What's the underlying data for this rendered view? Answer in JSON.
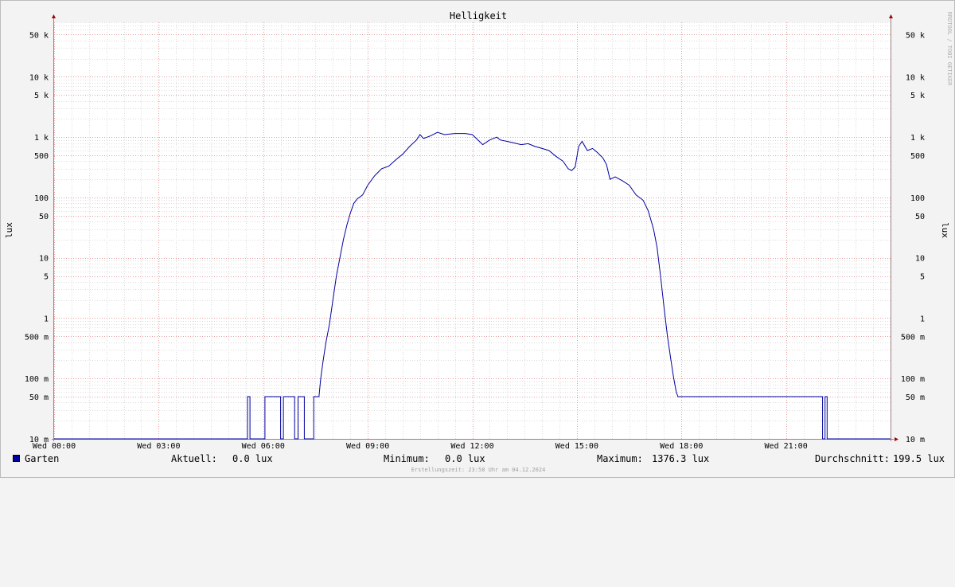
{
  "watermark": "RRDTOOL / TOBI OETIKER",
  "legend": {
    "series_name": "Garten",
    "series_color": "#0000a0",
    "current_label": "Aktuell:",
    "current_value": "0.0 lux",
    "min_label": "Minimum:",
    "min_value": "0.0 lux",
    "max_label": "Maximum:",
    "max_value": "1376.3 lux",
    "avg_label": "Durchschnitt:",
    "avg_value": "199.5 lux"
  },
  "footer": "Erstellungszeit: 23:58 Uhr am 04.12.2024",
  "colors": {
    "background": "#f3f3f3",
    "plot_background": "#ffffff",
    "grid_minor": "#dcdcdc",
    "grid_major": "#e8a0a0",
    "axis": "#a08080",
    "arrow": "#a00000",
    "line": "#0000a0"
  },
  "chart_data": {
    "type": "line",
    "title": "Helligkeit",
    "xlabel": "",
    "ylabel": "lux",
    "ylabel_right": "lux",
    "y_scale": "log",
    "ylim": [
      0.01,
      80000
    ],
    "xlim": [
      0,
      24
    ],
    "grid": true,
    "legend_position": "bottom",
    "x_ticks": [
      {
        "value": 0,
        "label": "Wed 00:00"
      },
      {
        "value": 3,
        "label": "Wed 03:00"
      },
      {
        "value": 6,
        "label": "Wed 06:00"
      },
      {
        "value": 9,
        "label": "Wed 09:00"
      },
      {
        "value": 12,
        "label": "Wed 12:00"
      },
      {
        "value": 15,
        "label": "Wed 15:00"
      },
      {
        "value": 18,
        "label": "Wed 18:00"
      },
      {
        "value": 21,
        "label": "Wed 21:00"
      }
    ],
    "y_ticks": [
      {
        "value": 0.01,
        "label": "10 m"
      },
      {
        "value": 0.05,
        "label": "50 m"
      },
      {
        "value": 0.1,
        "label": "100 m"
      },
      {
        "value": 0.5,
        "label": "500 m"
      },
      {
        "value": 1,
        "label": "1"
      },
      {
        "value": 5,
        "label": "5"
      },
      {
        "value": 10,
        "label": "10"
      },
      {
        "value": 50,
        "label": "50"
      },
      {
        "value": 100,
        "label": "100"
      },
      {
        "value": 500,
        "label": "500"
      },
      {
        "value": 1000,
        "label": "1 k"
      },
      {
        "value": 5000,
        "label": "5 k"
      },
      {
        "value": 10000,
        "label": "10 k"
      },
      {
        "value": 50000,
        "label": "50 k"
      }
    ],
    "series": [
      {
        "name": "Garten",
        "color": "#0000a0",
        "points": [
          [
            0.0,
            0.01
          ],
          [
            5.55,
            0.01
          ],
          [
            5.55,
            0.05
          ],
          [
            5.62,
            0.05
          ],
          [
            5.62,
            0.01
          ],
          [
            6.05,
            0.01
          ],
          [
            6.05,
            0.05
          ],
          [
            6.5,
            0.05
          ],
          [
            6.5,
            0.01
          ],
          [
            6.58,
            0.01
          ],
          [
            6.58,
            0.05
          ],
          [
            6.9,
            0.05
          ],
          [
            6.9,
            0.01
          ],
          [
            7.0,
            0.01
          ],
          [
            7.0,
            0.05
          ],
          [
            7.18,
            0.05
          ],
          [
            7.18,
            0.01
          ],
          [
            7.45,
            0.01
          ],
          [
            7.45,
            0.05
          ],
          [
            7.6,
            0.05
          ],
          [
            7.65,
            0.1
          ],
          [
            7.72,
            0.2
          ],
          [
            7.8,
            0.4
          ],
          [
            7.9,
            0.8
          ],
          [
            8.0,
            2
          ],
          [
            8.1,
            5
          ],
          [
            8.2,
            10
          ],
          [
            8.3,
            20
          ],
          [
            8.4,
            35
          ],
          [
            8.5,
            55
          ],
          [
            8.6,
            80
          ],
          [
            8.7,
            95
          ],
          [
            8.85,
            110
          ],
          [
            9.0,
            160
          ],
          [
            9.2,
            230
          ],
          [
            9.4,
            300
          ],
          [
            9.6,
            330
          ],
          [
            9.8,
            420
          ],
          [
            10.0,
            520
          ],
          [
            10.2,
            700
          ],
          [
            10.4,
            900
          ],
          [
            10.5,
            1100
          ],
          [
            10.6,
            950
          ],
          [
            10.8,
            1050
          ],
          [
            11.0,
            1200
          ],
          [
            11.2,
            1100
          ],
          [
            11.5,
            1150
          ],
          [
            11.8,
            1150
          ],
          [
            12.0,
            1100
          ],
          [
            12.2,
            850
          ],
          [
            12.3,
            750
          ],
          [
            12.5,
            900
          ],
          [
            12.7,
            1000
          ],
          [
            12.8,
            900
          ],
          [
            13.0,
            850
          ],
          [
            13.2,
            800
          ],
          [
            13.4,
            750
          ],
          [
            13.6,
            780
          ],
          [
            13.8,
            700
          ],
          [
            14.0,
            650
          ],
          [
            14.2,
            600
          ],
          [
            14.4,
            480
          ],
          [
            14.6,
            400
          ],
          [
            14.75,
            300
          ],
          [
            14.85,
            280
          ],
          [
            14.95,
            320
          ],
          [
            15.05,
            700
          ],
          [
            15.15,
            850
          ],
          [
            15.3,
            600
          ],
          [
            15.45,
            650
          ],
          [
            15.6,
            550
          ],
          [
            15.75,
            450
          ],
          [
            15.85,
            350
          ],
          [
            15.95,
            200
          ],
          [
            16.1,
            220
          ],
          [
            16.3,
            190
          ],
          [
            16.5,
            160
          ],
          [
            16.7,
            110
          ],
          [
            16.9,
            90
          ],
          [
            17.05,
            60
          ],
          [
            17.2,
            30
          ],
          [
            17.3,
            15
          ],
          [
            17.4,
            5
          ],
          [
            17.5,
            1.5
          ],
          [
            17.6,
            0.5
          ],
          [
            17.7,
            0.2
          ],
          [
            17.78,
            0.1
          ],
          [
            17.85,
            0.06
          ],
          [
            17.9,
            0.05
          ],
          [
            22.0,
            0.05
          ],
          [
            22.05,
            0.05
          ],
          [
            22.05,
            0.01
          ],
          [
            22.12,
            0.01
          ],
          [
            22.12,
            0.05
          ],
          [
            22.18,
            0.05
          ],
          [
            22.18,
            0.01
          ],
          [
            24.0,
            0.01
          ]
        ]
      }
    ]
  }
}
